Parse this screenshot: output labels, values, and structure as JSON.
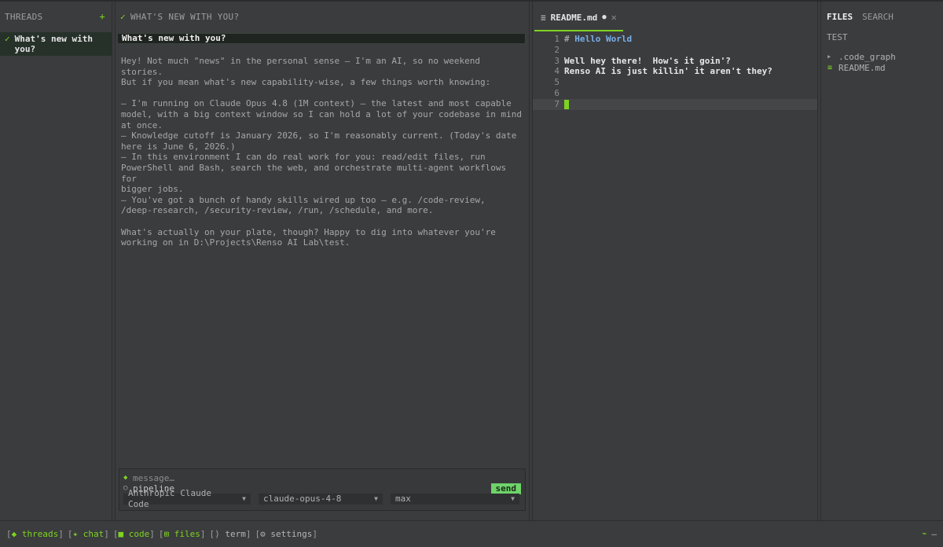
{
  "threads": {
    "header": "THREADS",
    "add_icon": "+",
    "items": [
      {
        "title": "What's new with\nyou?",
        "selected": true
      }
    ]
  },
  "chat": {
    "header": "WHAT'S NEW WITH YOU?",
    "selected_title": "What's new with you?",
    "message": "Hey! Not much \"news\" in the personal sense — I'm an AI, so no weekend stories.\nBut if you mean what's new capability-wise, a few things worth knowing:\n\n– I'm running on Claude Opus 4.8 (1M context) — the latest and most capable\nmodel, with a big context window so I can hold a lot of your codebase in mind\nat once.\n– Knowledge cutoff is January 2026, so I'm reasonably current. (Today's date\nhere is June 6, 2026.)\n– In this environment I can do real work for you: read/edit files, run\nPowerShell and Bash, search the web, and orchestrate multi-agent workflows for\nbigger jobs.\n– You've got a bunch of handy skills wired up too — e.g. /code-review,\n/deep-research, /security-review, /run, /schedule, and more.\n\nWhat's actually on your plate, though? Happy to dig into whatever you're\nworking on in D:\\Projects\\Renso AI Lab\\test.",
    "composer": {
      "placeholder": "message…",
      "pipeline_label": "pipeline",
      "send_label": "send",
      "provider": "Anthropic Claude Code",
      "model": "claude-opus-4-8",
      "effort": "max"
    }
  },
  "editor": {
    "tab_name": "README.md",
    "modified_dot": "●",
    "close": "✕",
    "lines": [
      {
        "n": "1",
        "hash": "#",
        "text": "Hello World",
        "heading": true
      },
      {
        "n": "2",
        "text": ""
      },
      {
        "n": "3",
        "text": "Well hey there!  How's it goin'?"
      },
      {
        "n": "4",
        "text": "Renso AI is just killin' it aren't they?"
      },
      {
        "n": "5",
        "text": ""
      },
      {
        "n": "6",
        "text": ""
      },
      {
        "n": "7",
        "text": "",
        "cursor": true
      }
    ]
  },
  "files": {
    "tab_files": "FILES",
    "tab_search": "SEARCH",
    "root": "TEST",
    "items": [
      {
        "name": ".code_graph",
        "kind": "folder"
      },
      {
        "name": "README.md",
        "kind": "markdown"
      }
    ]
  },
  "statusbar": {
    "items": [
      {
        "glyph": "◆",
        "label": "threads"
      },
      {
        "glyph": "✦",
        "label": "chat"
      },
      {
        "glyph": "■",
        "label": "code"
      },
      {
        "glyph": "⊞",
        "label": "files"
      },
      {
        "glyph": "⟩",
        "label": "term"
      },
      {
        "glyph": "⚙",
        "label": "settings"
      }
    ],
    "right_minus": "–"
  },
  "colors": {
    "accent": "#7ed321",
    "send_bg": "#6fd36a",
    "heading": "#79aee8",
    "background": "#3b3c3e"
  }
}
